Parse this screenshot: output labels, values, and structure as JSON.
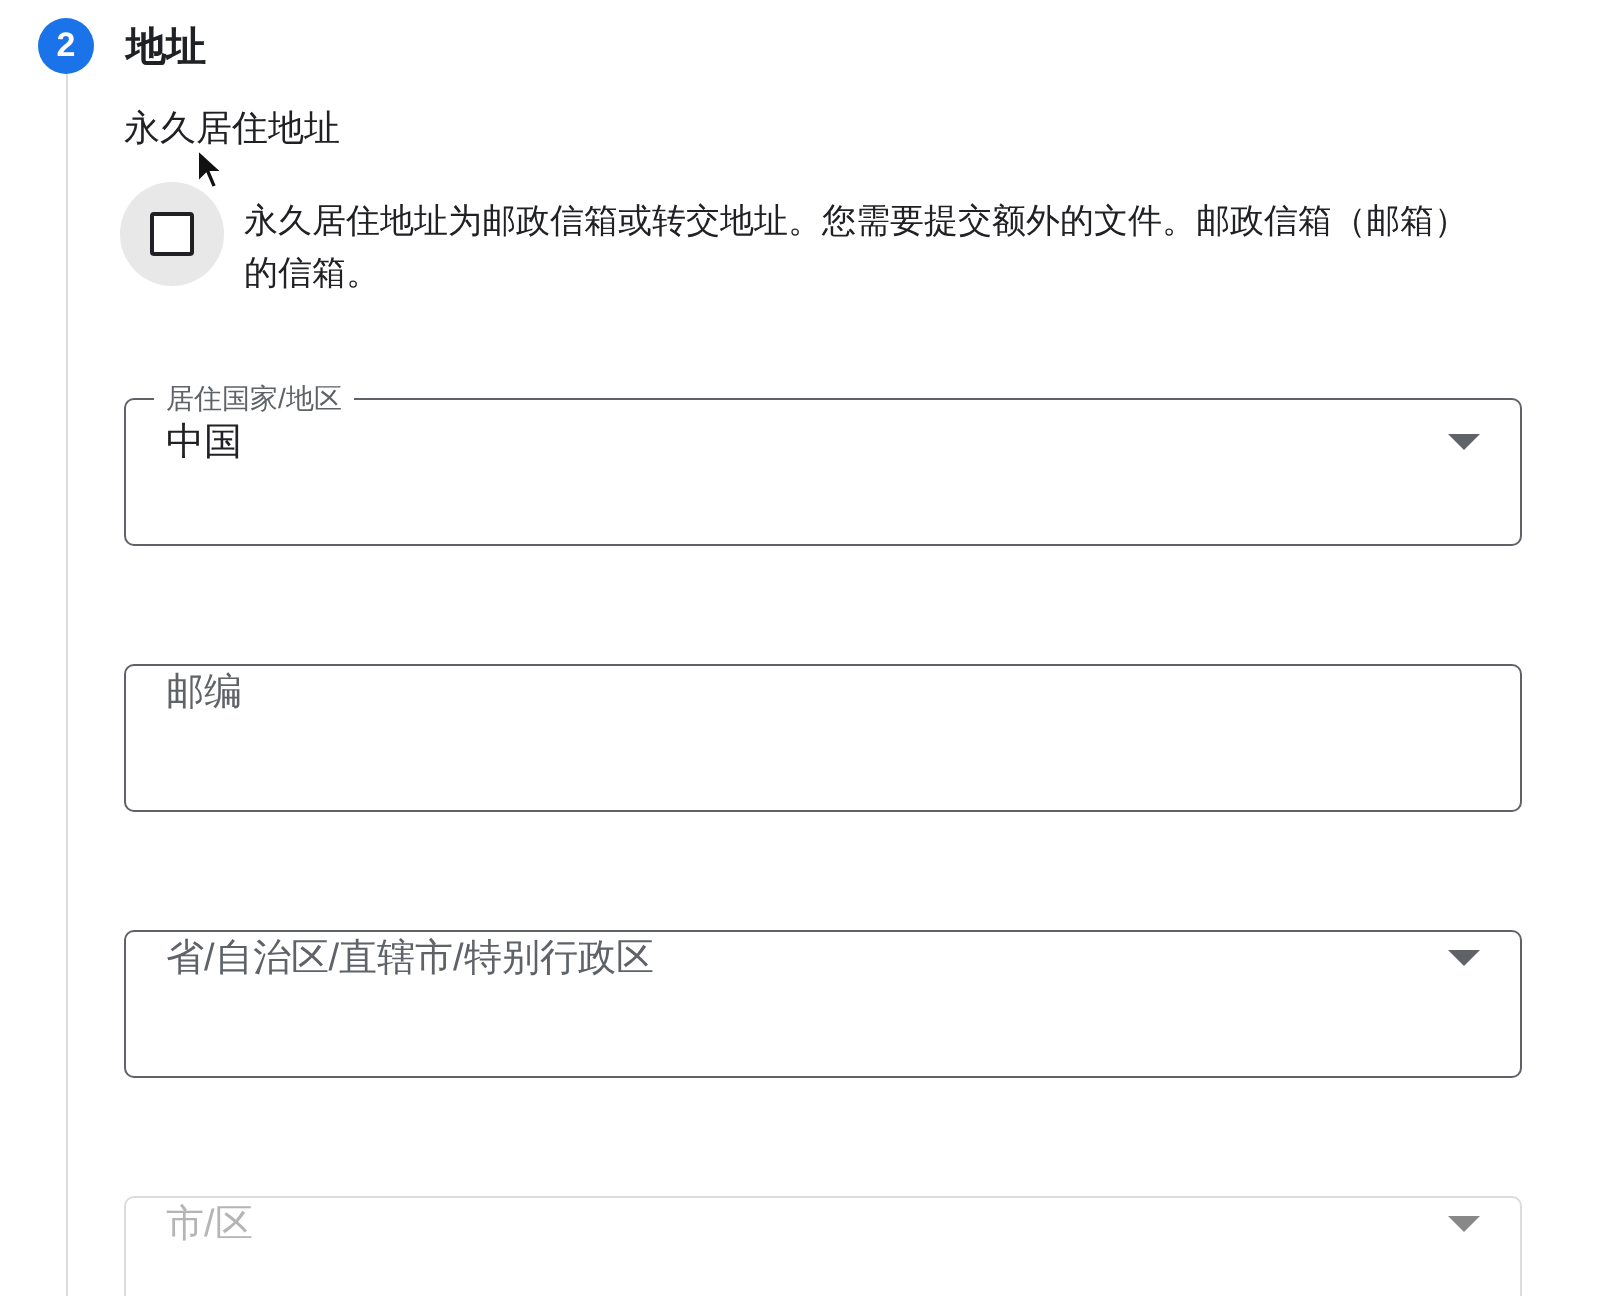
{
  "step": {
    "number": "2",
    "title": "地址"
  },
  "section_label": "永久居住地址",
  "checkbox": {
    "label": "永久居住地址为邮政信箱或转交地址。您需要提交额外的文件。邮政信箱（邮箱）的信箱。",
    "checked": false
  },
  "fields": [
    {
      "kind": "select",
      "label": "居住国家/地区",
      "value": "中国",
      "disabled": false
    },
    {
      "kind": "text",
      "placeholder": "邮编",
      "disabled": false
    },
    {
      "kind": "select",
      "placeholder": "省/自治区/直辖市/特别行政区",
      "disabled": false
    },
    {
      "kind": "select",
      "placeholder": "市/区",
      "disabled": true
    }
  ]
}
